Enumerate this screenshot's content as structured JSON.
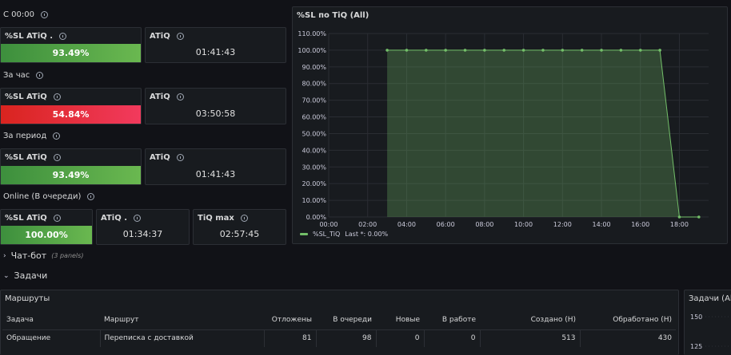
{
  "groups": {
    "since_midnight": "С 00:00",
    "per_hour": "За час",
    "per_period": "За период",
    "online": "Online (В очереди)"
  },
  "stats": {
    "g1_sl_title": "%SL ATiQ .",
    "g1_sl_value": "93.49%",
    "g1_sl_fraction": 0.935,
    "g1_atiq_title": "ATiQ",
    "g1_atiq_value": "01:41:43",
    "g2_sl_title": "%SL ATiQ",
    "g2_sl_value": "54.84%",
    "g2_sl_fraction": 0.548,
    "g2_atiq_title": "ATiQ",
    "g2_atiq_value": "03:50:58",
    "g3_sl_title": "%SL ATiQ",
    "g3_sl_value": "93.49%",
    "g3_sl_fraction": 0.935,
    "g3_atiq_title": "ATiQ",
    "g3_atiq_value": "01:41:43",
    "g4_sl_title": "%SL ATiQ",
    "g4_sl_value": "100.00%",
    "g4_sl_fraction": 1.0,
    "g4_atiq_title": "ATiQ .",
    "g4_atiq_value": "01:34:37",
    "g4_tiq_title": "TiQ max",
    "g4_tiq_value": "02:57:45"
  },
  "colors": {
    "green": "#6ab850",
    "red": "#f23a5d",
    "line": "#73bf69"
  },
  "chart": {
    "title": "%SL по TiQ (All)",
    "legend_series": "%SL_TiQ",
    "legend_last": "Last *: 0.00%"
  },
  "chart_data": {
    "type": "area",
    "x_labels": [
      "00:00",
      "02:00",
      "04:00",
      "06:00",
      "08:00",
      "10:00",
      "12:00",
      "14:00",
      "16:00",
      "18:00"
    ],
    "y_labels": [
      "0.00%",
      "10.00%",
      "20.00%",
      "30.00%",
      "40.00%",
      "50.00%",
      "60.00%",
      "70.00%",
      "80.00%",
      "90.00%",
      "100.00%",
      "110.00%"
    ],
    "x_hours": [
      3,
      4,
      5,
      6,
      7,
      8,
      9,
      10,
      11,
      12,
      13,
      14,
      15,
      16,
      17,
      18,
      19
    ],
    "y": [
      100,
      100,
      100,
      100,
      100,
      100,
      100,
      100,
      100,
      100,
      100,
      100,
      100,
      100,
      100,
      0,
      0
    ],
    "xlim": [
      0,
      19.5
    ],
    "ylim": [
      0,
      110
    ],
    "grid": true,
    "legend": "bottom-left"
  },
  "rows": {
    "chatbot": "Чат-бот",
    "chatbot_sub": "(3 panels)",
    "tasks": "Задачи"
  },
  "routes": {
    "title": "Маршруты",
    "columns": [
      "Задача",
      "Маршрут",
      "Отложены",
      "В очереди",
      "Новые",
      "В работе",
      "Создано (Н)",
      "Обработано (Н)"
    ],
    "rows": [
      [
        "Обращение",
        "Переписка с доставкой",
        "81",
        "98",
        "0",
        "0",
        "513",
        "430"
      ]
    ]
  },
  "tasks_panel": {
    "title": "Задачи (All)",
    "y_labels": [
      "150",
      "125"
    ]
  }
}
